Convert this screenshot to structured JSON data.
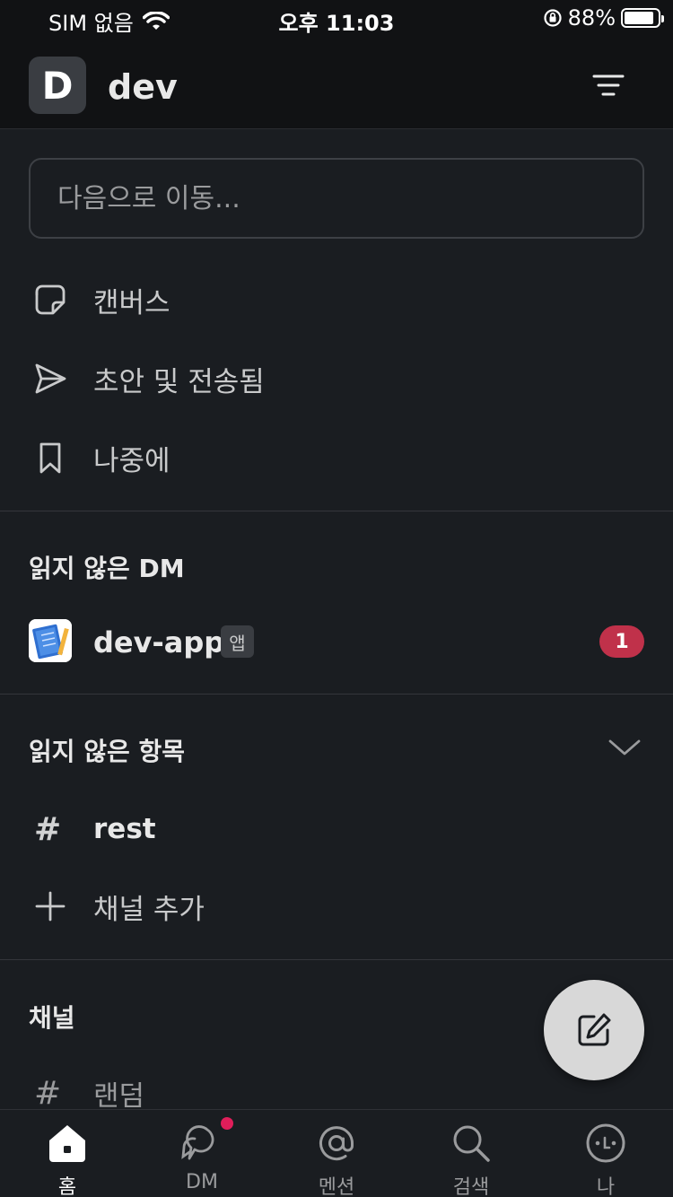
{
  "status_bar": {
    "carrier": "SIM 없음",
    "time": "오후 11:03",
    "battery": "88%",
    "battery_level": 0.88
  },
  "workspace": {
    "initial": "D",
    "name": "dev"
  },
  "search": {
    "placeholder": "다음으로 이동..."
  },
  "shortcuts": [
    {
      "label": "캔버스",
      "icon": "canvas-icon"
    },
    {
      "label": "초안 및 전송됨",
      "icon": "send-icon"
    },
    {
      "label": "나중에",
      "icon": "bookmark-icon"
    }
  ],
  "unread_dm": {
    "title": "읽지 않은 DM",
    "items": [
      {
        "name": "dev-app",
        "tag": "앱",
        "count": "1"
      }
    ]
  },
  "unread_items": {
    "title": "읽지 않은 항목",
    "channels": [
      {
        "name": "rest"
      }
    ],
    "add_channel": "채널 추가"
  },
  "channels": {
    "title": "채널",
    "items": [
      {
        "name": "랜덤"
      }
    ]
  },
  "tabs": [
    {
      "label": "홈",
      "icon": "home-icon",
      "active": true
    },
    {
      "label": "DM",
      "icon": "dm-icon",
      "active": false
    },
    {
      "label": "멘션",
      "icon": "mention-icon",
      "active": false
    },
    {
      "label": "검색",
      "icon": "search-icon",
      "active": false
    },
    {
      "label": "나",
      "icon": "profile-icon",
      "active": false
    }
  ],
  "colors": {
    "background": "#1a1d21",
    "header": "#111214",
    "badge": "#c0314a",
    "notification_dot": "#e01e5a"
  }
}
